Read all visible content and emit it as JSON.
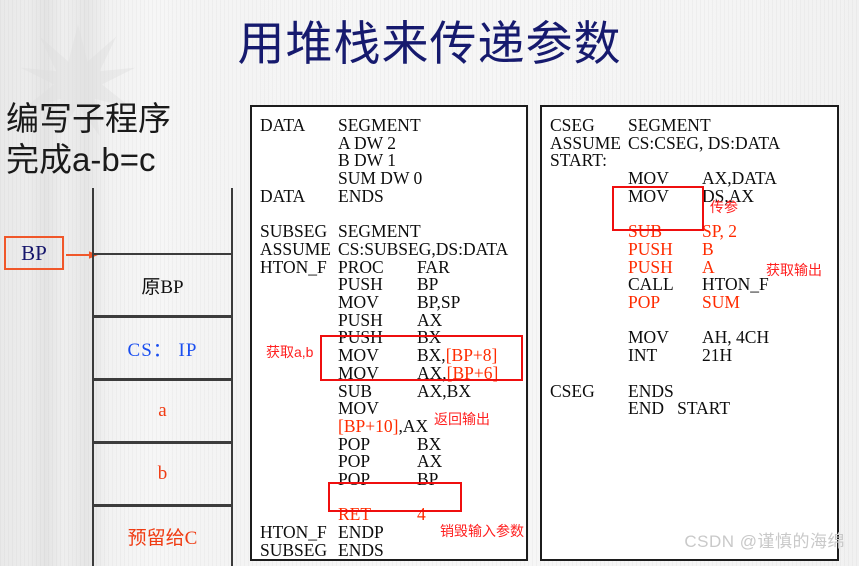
{
  "slide": {
    "title": "用堆栈来传递参数",
    "subtitle_line1": "编写子程序",
    "subtitle_line2": "完成a-b=c",
    "watermark": "CSDN @谨慎的海绵",
    "colors": {
      "title": "#161a6e",
      "accent_red": "#ff2b00",
      "highlight_box": "#ef0f0f",
      "stack_blue": "#1a4ef0",
      "bp_border": "#f0572a"
    }
  },
  "stack": {
    "pointer_label": "BP",
    "cells": [
      {
        "text": "原BP",
        "color": "black"
      },
      {
        "text": "CS： IP",
        "color": "blue"
      },
      {
        "text": "a",
        "color": "red"
      },
      {
        "text": "b",
        "color": "red"
      },
      {
        "text": "预留给C",
        "color": "red"
      }
    ]
  },
  "panel_mid": {
    "lines": [
      {
        "col1": "DATA",
        "col2": "SEGMENT",
        "col3": ""
      },
      {
        "col1": "",
        "col2": "A DW 2",
        "col3": ""
      },
      {
        "col1": "",
        "col2": "B DW 1",
        "col3": ""
      },
      {
        "col1": "",
        "col2": "SUM DW 0",
        "col3": ""
      },
      {
        "col1": "DATA",
        "col2": "ENDS",
        "col3": ""
      },
      {
        "col1": "",
        "col2": "",
        "col3": ""
      },
      {
        "col1": "SUBSEG",
        "col2": "SEGMENT",
        "col3": ""
      },
      {
        "col1": "ASSUME",
        "col2": "CS:SUBSEG,DS:DATA",
        "col3": ""
      },
      {
        "col1": "HTON_F",
        "col2": "PROC",
        "col3": "FAR"
      },
      {
        "col1": "",
        "col2": "PUSH",
        "col3": "BP"
      },
      {
        "col1": "",
        "col2": "MOV",
        "col3": "BP,SP"
      },
      {
        "col1": "",
        "col2": "PUSH",
        "col3": "AX"
      },
      {
        "col1": "",
        "col2": "PUSH",
        "col3": "BX"
      },
      {
        "col1": "",
        "col2": "MOV",
        "col3": "BX,[BP+8]"
      },
      {
        "col1": "",
        "col2": "MOV",
        "col3": "AX,[BP+6]"
      },
      {
        "col1": "",
        "col2": "SUB",
        "col3": "AX,BX"
      },
      {
        "col1": "",
        "col2": "MOV",
        "col3": ""
      },
      {
        "col1": "",
        "col2": "[BP+10],AX",
        "col3": ""
      },
      {
        "col1": "",
        "col2": "POP",
        "col3": "BX"
      },
      {
        "col1": "",
        "col2": "POP",
        "col3": "AX"
      },
      {
        "col1": "",
        "col2": "POP",
        "col3": "BP"
      },
      {
        "col1": "",
        "col2": "",
        "col3": ""
      },
      {
        "col1": "",
        "col2": "RET",
        "col3": "4"
      },
      {
        "col1": "HTON_F",
        "col2": "ENDP",
        "col3": ""
      },
      {
        "col1": "SUBSEG",
        "col2": "ENDS",
        "col3": ""
      }
    ],
    "red_fragments": {
      "bp8": "[BP+8]",
      "bp6": "[BP+6]",
      "bp10": "[BP+10]",
      "ret": "RET",
      "ret_operand": "4"
    },
    "annotations": {
      "fetch_ab": "获取a,b",
      "return_output": "返回输出",
      "destroy_params": "销毁输入参数"
    }
  },
  "panel_right": {
    "lines": [
      {
        "col1": "CSEG",
        "col2": "SEGMENT",
        "col3": ""
      },
      {
        "col1": "ASSUME",
        "col2": "CS:CSEG, DS:DATA",
        "col3": ""
      },
      {
        "col1": "START:",
        "col2": "",
        "col3": ""
      },
      {
        "col1": "",
        "col2": "MOV",
        "col3": "AX,DATA"
      },
      {
        "col1": "",
        "col2": "MOV",
        "col3": "DS,AX"
      },
      {
        "col1": "",
        "col2": "",
        "col3": ""
      },
      {
        "col1": "",
        "col2": "SUB",
        "col3": "SP, 2"
      },
      {
        "col1": "",
        "col2": "PUSH",
        "col3": "B"
      },
      {
        "col1": "",
        "col2": "PUSH",
        "col3": "A"
      },
      {
        "col1": "",
        "col2": "CALL",
        "col3": "HTON_F"
      },
      {
        "col1": "",
        "col2": "POP",
        "col3": "SUM"
      },
      {
        "col1": "",
        "col2": "",
        "col3": ""
      },
      {
        "col1": "",
        "col2": "MOV",
        "col3": "AH, 4CH"
      },
      {
        "col1": "",
        "col2": "INT",
        "col3": "21H"
      },
      {
        "col1": "",
        "col2": "",
        "col3": ""
      },
      {
        "col1": "CSEG",
        "col2": "ENDS",
        "col3": ""
      },
      {
        "col1": "",
        "col2": "END   START",
        "col3": ""
      }
    ],
    "annotations": {
      "pass_params": "传参",
      "fetch_output": "获取输出"
    }
  }
}
